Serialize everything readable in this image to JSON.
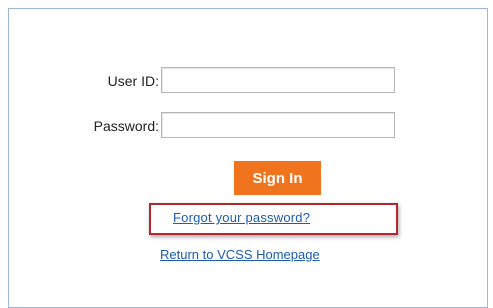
{
  "login": {
    "user_id_label": "User ID:",
    "user_id_value": "",
    "password_label": "Password:",
    "password_value": "",
    "sign_in_label": "Sign In"
  },
  "links": {
    "forgot_password": "Forgot your password?",
    "return_home": "Return to VCSS Homepage"
  },
  "colors": {
    "accent": "#f0731e",
    "link": "#1a5cb0",
    "highlight_border": "#b3282e",
    "panel_border": "#9bb6d9"
  }
}
